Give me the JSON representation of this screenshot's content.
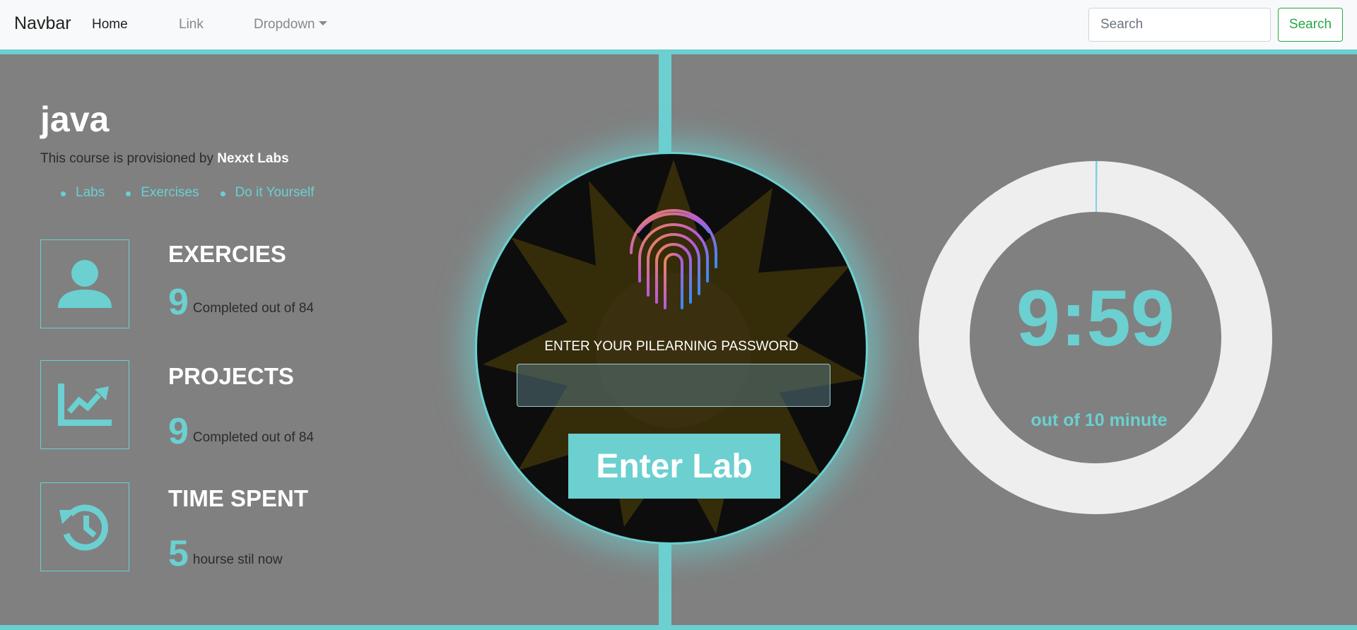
{
  "navbar": {
    "brand": "Navbar",
    "links": [
      {
        "label": "Home"
      },
      {
        "label": "Link"
      },
      {
        "label": "Dropdown"
      }
    ],
    "search": {
      "placeholder": "Search",
      "button_label": "Search"
    }
  },
  "course": {
    "title": "java",
    "provider_prefix": "This course is provisioned by",
    "provider_name": "Nexxt Labs",
    "links": [
      "Labs",
      "Exercises",
      "Do it Yourself"
    ]
  },
  "stats": [
    {
      "title": "EXERCIES",
      "value": "9",
      "caption": "Completed out of 84",
      "icon": "person-icon"
    },
    {
      "title": "PROJECTS",
      "value": "9",
      "caption": "Completed out of 84",
      "icon": "chart-line-icon"
    },
    {
      "title": "TIME SPENT",
      "value": "5",
      "caption": "hourse stil now",
      "icon": "history-icon"
    }
  ],
  "lock": {
    "prompt": "ENTER YOUR PILEARNING PASSWORD",
    "input_value": "",
    "button_label": "Enter Lab",
    "icon": "fingerprint-icon"
  },
  "timer": {
    "value": "9:59",
    "caption": "out of 10 minute",
    "elapsed_fraction": 0.0017
  },
  "colors": {
    "accent": "#6ccfd0",
    "panel": "#808080",
    "ring": "#eeeeee",
    "search_green": "#28a745"
  }
}
